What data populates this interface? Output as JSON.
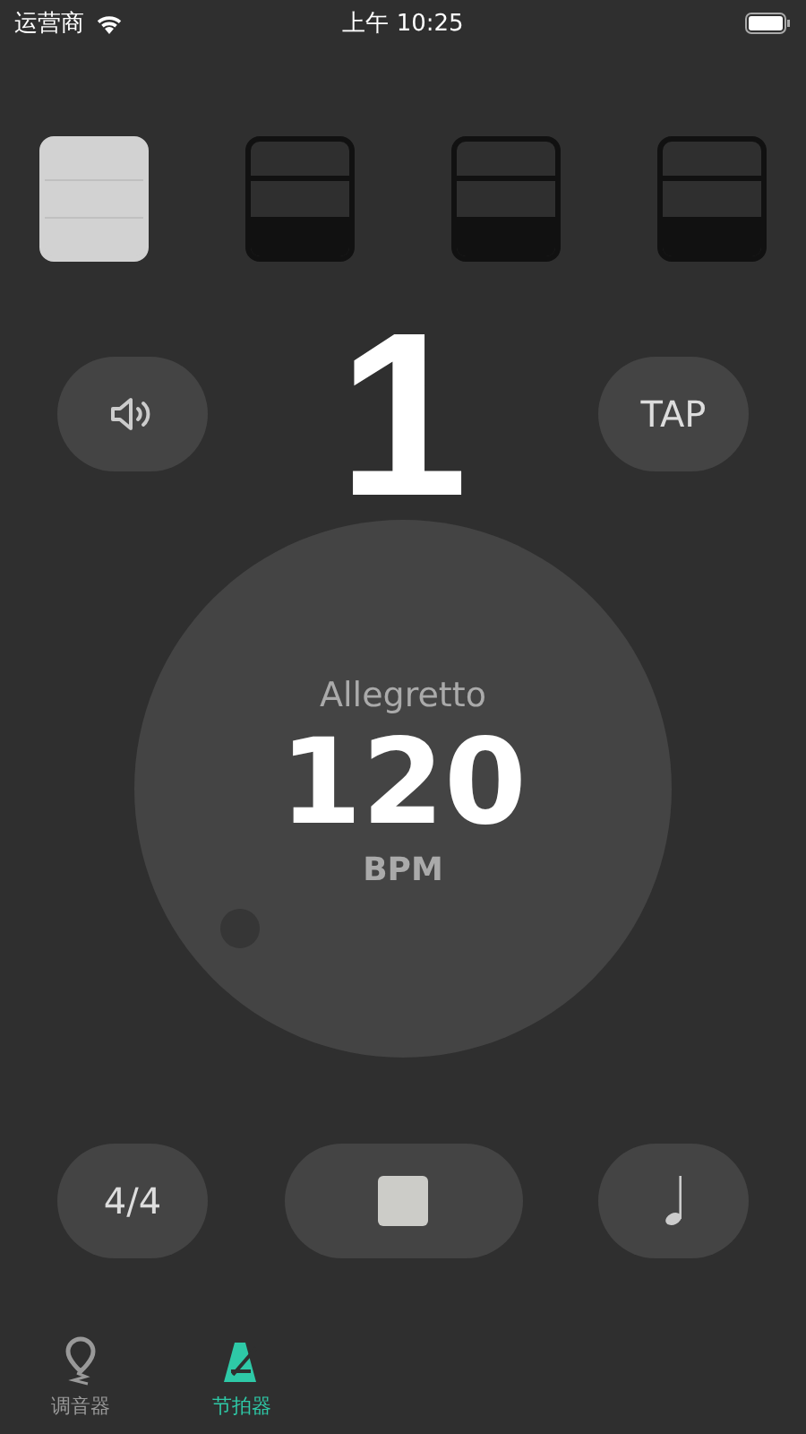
{
  "status_bar": {
    "carrier": "运营商",
    "time": "上午 10:25"
  },
  "beats": [
    {
      "selected": true,
      "kind": "weak"
    },
    {
      "selected": false,
      "kind": "weak"
    },
    {
      "selected": false,
      "kind": "weak"
    },
    {
      "selected": false,
      "kind": "weak"
    }
  ],
  "current_beat": "1",
  "tap_button": "TAP",
  "tempo": {
    "name": "Allegretto",
    "bpm": "120",
    "unit": "BPM"
  },
  "controls": {
    "time_signature": "4/4",
    "playing": true
  },
  "tabs": [
    {
      "label": "调音器",
      "kind": "tuner",
      "selected": false
    },
    {
      "label": "节拍器",
      "kind": "metronome",
      "selected": true
    }
  ]
}
